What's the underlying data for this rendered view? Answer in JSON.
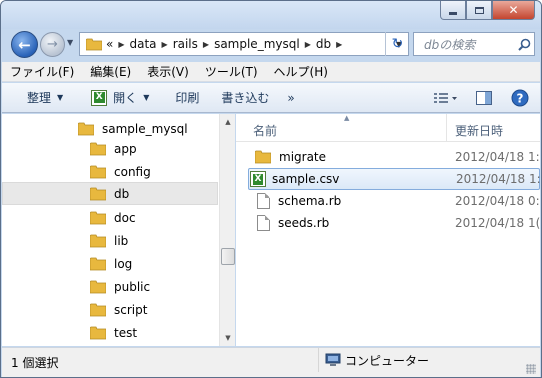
{
  "window": {
    "caption_buttons": [
      "minimize",
      "maximize",
      "close"
    ]
  },
  "nav": {
    "breadcrumb": [
      "data",
      "rails",
      "sample_mysql",
      "db"
    ],
    "breadcrumb_prefix": "«",
    "search_placeholder": "dbの検索"
  },
  "menu": [
    "ファイル(F)",
    "編集(E)",
    "表示(V)",
    "ツール(T)",
    "ヘルプ(H)"
  ],
  "toolbar": {
    "organize": "整理",
    "open": "開く",
    "print": "印刷",
    "burn": "書き込む",
    "more": "»"
  },
  "tree": {
    "parent": "sample_mysql",
    "items": [
      "app",
      "config",
      "db",
      "doc",
      "lib",
      "log",
      "public",
      "script",
      "test"
    ],
    "selected": "db"
  },
  "columns": {
    "name": "名前",
    "date": "更新日時"
  },
  "files": [
    {
      "name": "migrate",
      "date": "2012/04/18 1:",
      "type": "folder"
    },
    {
      "name": "sample.csv",
      "date": "2012/04/18 1:",
      "type": "csv",
      "selected": true
    },
    {
      "name": "schema.rb",
      "date": "2012/04/18 0:",
      "type": "doc"
    },
    {
      "name": "seeds.rb",
      "date": "2012/04/18 1(",
      "type": "doc"
    }
  ],
  "status": {
    "selection": "1 個選択",
    "location": "コンピューター"
  },
  "colors": {
    "chrome": "#c5d8ee",
    "accent": "#2a63b8",
    "folder": "#e8b83e",
    "close": "#c4452f"
  }
}
